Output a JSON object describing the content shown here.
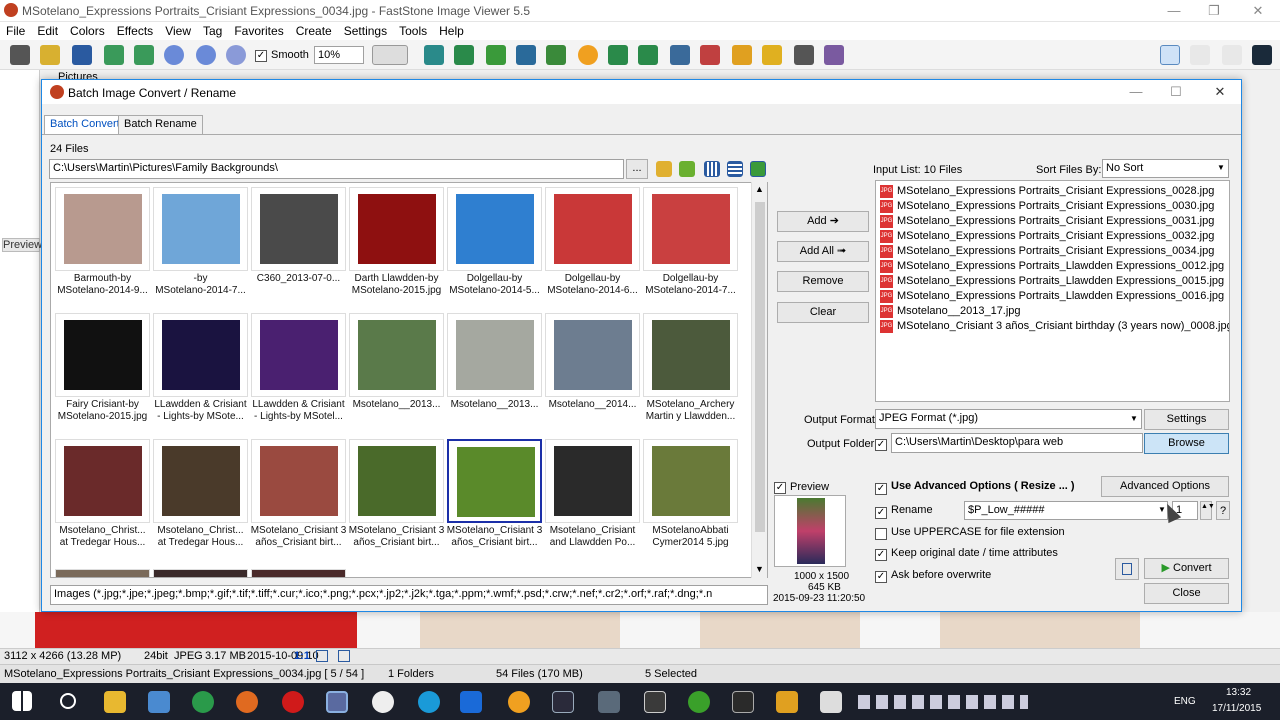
{
  "window": {
    "title": "MSotelano_Expressions Portraits_Crisiant Expressions_0034.jpg - FastStone Image Viewer 5.5"
  },
  "menu": [
    "File",
    "Edit",
    "Colors",
    "Effects",
    "View",
    "Tag",
    "Favorites",
    "Create",
    "Settings",
    "Tools",
    "Help"
  ],
  "toolbar": {
    "smooth_label": "Smooth",
    "zoom_value": "10%"
  },
  "left_pane": {
    "folder_label": "Pictures",
    "preview_label": "Preview"
  },
  "dialog": {
    "title": "Batch Image Convert / Rename",
    "tabs": [
      "Batch Convert",
      "Batch Rename"
    ],
    "file_count": "24 Files",
    "path": "C:\\Users\\Martin\\Pictures\\Family Backgrounds\\",
    "browse_dots": "...",
    "thumbnails": [
      {
        "line1": "Barmouth-by",
        "line2": "MSotelano-2014-9...",
        "color": "#b89a8f"
      },
      {
        "line1": "-by",
        "line2": "MSotelano-2014-7...",
        "color": "#6fa6d8"
      },
      {
        "line1": "C360_2013-07-0...",
        "line2": "",
        "color": "#4a4a4a"
      },
      {
        "line1": "Darth Llawdden-by",
        "line2": "MSotelano-2015.jpg",
        "color": "#8e1010"
      },
      {
        "line1": "Dolgellau-by",
        "line2": "MSotelano-2014-5...",
        "color": "#2f7fd0"
      },
      {
        "line1": "Dolgellau-by",
        "line2": "MSotelano-2014-6...",
        "color": "#c93838"
      },
      {
        "line1": "Dolgellau-by",
        "line2": "MSotelano-2014-7...",
        "color": "#c94040"
      },
      {
        "line1": "Fairy Crisiant-by",
        "line2": "MSotelano-2015.jpg",
        "color": "#111"
      },
      {
        "line1": "LLawdden & Crisiant",
        "line2": "- Lights-by MSote...",
        "color": "#1a1340"
      },
      {
        "line1": "LLawdden & Crisiant",
        "line2": "- Lights-by MSotel...",
        "color": "#4a2070"
      },
      {
        "line1": "Msotelano__2013...",
        "line2": "",
        "color": "#5a7a4a"
      },
      {
        "line1": "Msotelano__2013...",
        "line2": "",
        "color": "#a5a8a0"
      },
      {
        "line1": "Msotelano__2014...",
        "line2": "",
        "color": "#6d7d90"
      },
      {
        "line1": "MSotelano_Archery",
        "line2": "Martin y Llawdden...",
        "color": "#4c5a3c"
      },
      {
        "line1": "Msotelano_Christ...",
        "line2": "at Tredegar Hous...",
        "color": "#6a2a2a"
      },
      {
        "line1": "Msotelano_Christ...",
        "line2": "at Tredegar Hous...",
        "color": "#4a3a2a"
      },
      {
        "line1": "MSotelano_Crisiant 3",
        "line2": "años_Crisiant birt...",
        "color": "#9a4a40"
      },
      {
        "line1": "MSotelano_Crisiant 3",
        "line2": "años_Crisiant birt...",
        "color": "#4a6a2a"
      },
      {
        "line1": "MSotelano_Crisiant 3",
        "line2": "años_Crisiant birt...",
        "color": "#5a8a2a"
      },
      {
        "line1": "Msotelano_Crisiant",
        "line2": "and Llawdden Po...",
        "color": "#2a2a2a"
      },
      {
        "line1": "MSotelanoAbbati",
        "line2": "Cymer2014 5.jpg",
        "color": "#6a7a3a"
      }
    ],
    "selected_thumb_index": 18,
    "filter_text": "Images (*.jpg;*.jpe;*.jpeg;*.bmp;*.gif;*.tif;*.tiff;*.cur;*.ico;*.png;*.pcx;*.jp2;*.j2k;*.tga;*.ppm;*.wmf;*.psd;*.crw;*.nef;*.cr2;*.orf;*.raf;*.dng;*.n",
    "buttons": {
      "add": "Add ➔",
      "add_all": "Add All ➟",
      "remove": "Remove",
      "clear": "Clear"
    },
    "input_list_label": "Input List:  10 Files",
    "sort_label": "Sort Files By:",
    "sort_value": "No Sort",
    "input_files": [
      "MSotelano_Expressions Portraits_Crisiant Expressions_0028.jpg",
      "MSotelano_Expressions Portraits_Crisiant Expressions_0030.jpg",
      "MSotelano_Expressions Portraits_Crisiant Expressions_0031.jpg",
      "MSotelano_Expressions Portraits_Crisiant Expressions_0032.jpg",
      "MSotelano_Expressions Portraits_Crisiant Expressions_0034.jpg",
      "MSotelano_Expressions Portraits_Llawdden Expressions_0012.jpg",
      "MSotelano_Expressions Portraits_Llawdden Expressions_0015.jpg",
      "MSotelano_Expressions Portraits_Llawdden Expressions_0016.jpg",
      "Msotelano__2013_17.jpg",
      "MSotelano_Crisiant 3 años_Crisiant birthday (3 years now)_0008.jpg"
    ],
    "output_format_label": "Output Format:",
    "output_format_value": "JPEG Format (*.jpg)",
    "settings_button": "Settings",
    "output_folder_label": "Output Folder:",
    "output_folder_value": "C:\\Users\\Martin\\Desktop\\para web",
    "browse_button": "Browse",
    "preview_label": "Preview",
    "preview_dims": "1000 x 1500",
    "preview_size": "645 KB",
    "preview_date": "2015-09-23 11:20:50",
    "use_advanced_label": "Use Advanced Options ( Resize ... )",
    "advanced_button": "Advanced Options",
    "rename_label": "Rename",
    "rename_value": "$P_Low_#####",
    "rename_start": "1",
    "help_button": "?",
    "uppercase_label": "Use UPPERCASE for file extension",
    "keep_date_label": "Keep original date / time attributes",
    "ask_overwrite_label": "Ask before overwrite",
    "convert_button": "Convert",
    "close_button": "Close"
  },
  "status": {
    "dims": "3112 x 4266 (13.28 MP)",
    "bit": "24bit",
    "fmt": "JPEG",
    "size": "3.17 MB",
    "date": "2015-10-09 10",
    "ratio": "1:1",
    "file": "MSotelano_Expressions Portraits_Crisiant Expressions_0034.jpg [ 5 / 54 ]",
    "folders": "1 Folders",
    "files": "54 Files (170 MB)",
    "selected": "5 Selected"
  },
  "taskbar": {
    "lang": "ENG",
    "time": "13:32",
    "date": "17/11/2015"
  }
}
